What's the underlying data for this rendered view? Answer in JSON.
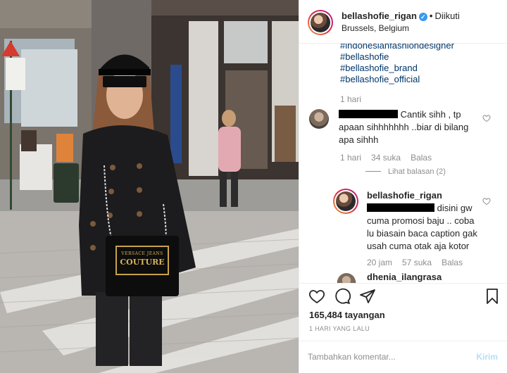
{
  "post": {
    "username": "bellashofie_rigan",
    "follow_status": "Diikuti",
    "location": "Brussels, Belgium"
  },
  "caption": {
    "hashtags": [
      "#indonesianfashiondesigner",
      "#bellashofie",
      "#bellashofie_brand",
      "#bellashofie_official"
    ],
    "time": "1 hari"
  },
  "comments": [
    {
      "text_line1": "Cantik sihh , tp",
      "text_line2": "apaan sihhhhhhh ..biar di bilang",
      "text_line3": "apa sihhh",
      "time": "1 hari",
      "likes": "34 suka",
      "reply_label": "Balas",
      "view_replies": "Lihat balasan (2)"
    }
  ],
  "reply": {
    "username": "bellashofie_rigan",
    "text_line1": "disini gw",
    "text_line2": "cuma promosi baju .. coba",
    "text_line3": "lu biasain baca caption gak",
    "text_line4": "usah cuma otak aja kotor",
    "time": "20 jam",
    "likes": "57 suka",
    "reply_label": "Balas"
  },
  "next_comment_partial": "dhenia_ilangrasa",
  "stats": {
    "views": "165,484 tayangan",
    "time_ago": "1 HARI YANG LALU"
  },
  "comment_box": {
    "placeholder": "Tambahkan komentar...",
    "post_label": "Kirim"
  },
  "photo": {
    "bag_text_line1": "VERSACE JEANS",
    "bag_text_line2": "COUTURE"
  },
  "colors": {
    "link": "#003569",
    "muted": "#8e8e8e",
    "verified": "#3897f0",
    "post_disabled": "#b2dffc"
  },
  "icons": [
    "heart-icon",
    "comment-icon",
    "share-icon",
    "bookmark-icon",
    "verified-badge-icon"
  ]
}
